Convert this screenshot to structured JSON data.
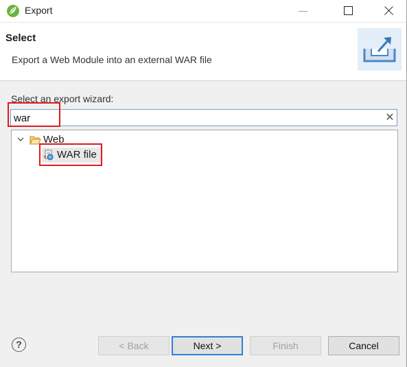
{
  "window": {
    "title": "Export",
    "icon": "spring-leaf-icon",
    "controls": [
      "minimize-icon",
      "maximize-icon",
      "close-icon"
    ]
  },
  "header": {
    "title": "Select",
    "description": "Export a Web Module into an external WAR file",
    "banner_icon": "export-tray-icon"
  },
  "wizard": {
    "prompt": "Select an export wizard:",
    "filter_value": "war",
    "clear_symbol": "✕",
    "tree": [
      {
        "label": "Web",
        "icon": "folder-open-icon",
        "expanded": true,
        "children": [
          {
            "label": "WAR file",
            "icon": "war-file-icon",
            "selected": true
          }
        ]
      }
    ]
  },
  "buttons": {
    "help": "?",
    "back": "< Back",
    "next": "Next >",
    "finish": "Finish",
    "cancel": "Cancel"
  },
  "colors": {
    "highlight": "#e0191e",
    "focus": "#2f7ed8"
  }
}
